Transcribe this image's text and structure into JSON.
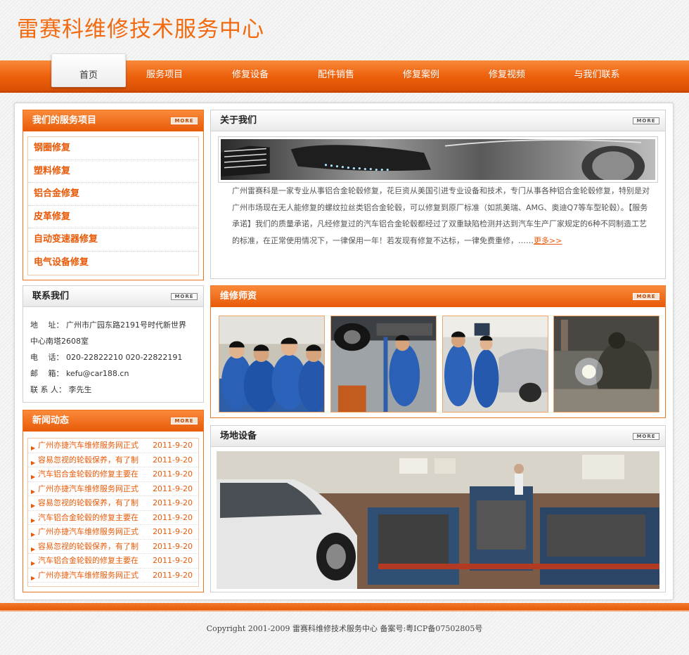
{
  "site": {
    "title": "雷赛科维修技术服务中心"
  },
  "nav": {
    "items": [
      {
        "label": "首页",
        "active": true
      },
      {
        "label": "服务项目"
      },
      {
        "label": "修复设备"
      },
      {
        "label": "配件销售"
      },
      {
        "label": "修复案例"
      },
      {
        "label": "修复视频"
      },
      {
        "label": "与我们联系"
      }
    ]
  },
  "more_label": "MORE",
  "services": {
    "title": "我们的服务项目",
    "items": [
      "钢圈修复",
      "塑料修复",
      "铝合金修复",
      "皮革修复",
      "自动变速器修复",
      "电气设备修复"
    ]
  },
  "contact": {
    "title": "联系我们",
    "address_label": "地　 址：",
    "address": "广州市广园东路2191号时代新世界",
    "address2": "中心南塔2608室",
    "phone_label": "电　 话：",
    "phone": "020-22822210 020-22822191",
    "email_label": "邮　 箱：",
    "email": "kefu@car188.cn",
    "person_label": "联 系 人：",
    "person": "李先生"
  },
  "news": {
    "title": "新闻动态",
    "items": [
      {
        "title": "广州亦捷汽车维修服务网正式",
        "date": "2011-9-20"
      },
      {
        "title": "容易忽视的轮毂保养，有了制",
        "date": "2011-9-20"
      },
      {
        "title": "汽车铝合金轮毂的修复主要在",
        "date": "2011-9-20"
      },
      {
        "title": "广州亦捷汽车维修服务网正式",
        "date": "2011-9-20"
      },
      {
        "title": "容易忽视的轮毂保养，有了制",
        "date": "2011-9-20"
      },
      {
        "title": "汽车铝合金轮毂的修复主要在",
        "date": "2011-9-20"
      },
      {
        "title": "广州亦捷汽车维修服务网正式",
        "date": "2011-9-20"
      },
      {
        "title": "容易忽视的轮毂保养，有了制",
        "date": "2011-9-20"
      },
      {
        "title": "汽车铝合金轮毂的修复主要在",
        "date": "2011-9-20"
      },
      {
        "title": "广州亦捷汽车维修服务网正式",
        "date": "2011-9-20"
      }
    ]
  },
  "about": {
    "title": "关于我们",
    "text": "广州雷赛科是一家专业从事铝合金轮毂修复，花巨资从美国引进专业设备和技术，专门从事各种铝合金轮毂修复，特别是对广州市场现在无人能修复的螺纹拉丝类铝合金轮毂，可以修复到原厂标准（如凯美瑞、AMG、奥迪Q7等车型轮毂）。【服务承诺】我们的质量承诺，凡经修复过的汽车铝合金轮毂都经过了双重缺陷检测并达到汽车生产厂家规定的6种不同制造工艺的标准，在正常使用情况下，一律保用一年！若发现有修复不达标，一律免费重修，……",
    "more": "更多>>"
  },
  "staff": {
    "title": "维修师资"
  },
  "equipment": {
    "title": "场地设备"
  },
  "footer": {
    "copyright": "Copyright 2001-2009 雷赛科维修技术服务中心 备案号:粤ICP备07502805号"
  },
  "colors": {
    "accent": "#ec5f0b",
    "text_accent": "#e85a08"
  }
}
